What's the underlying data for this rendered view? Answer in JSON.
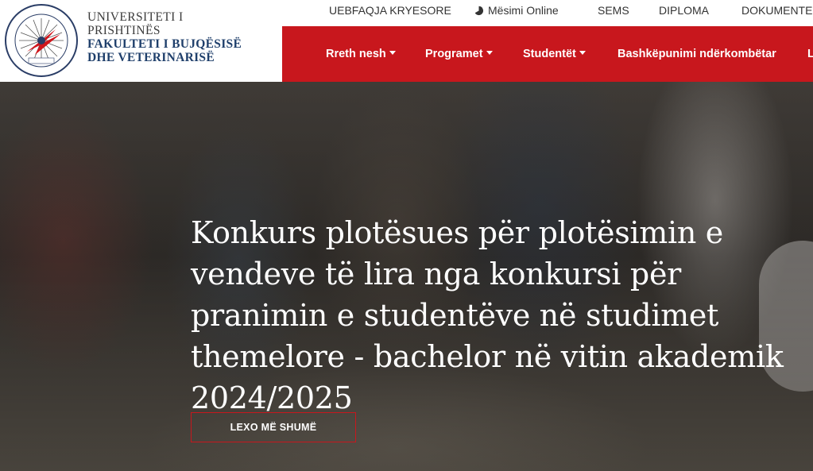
{
  "logo": {
    "university": [
      "UNIVERSITETI I",
      "PRISHTINËS"
    ],
    "faculty": [
      "FAKULTETI I BUJQËSISË",
      "DHE VETERINARISË"
    ]
  },
  "topbar": {
    "items": [
      "UEBFAQJA KRYESORE",
      "Mësimi Online",
      "SEMS",
      "DIPLOMA",
      "DOKUMENTE"
    ]
  },
  "mainnav": {
    "items": [
      "Rreth nesh",
      "Programet",
      "Studentët",
      "Bashkëpunimi ndërkombëtar",
      "L"
    ]
  },
  "hero": {
    "title": "Konkurs plotësues për plotësimin e vendeve të lira nga konkursi për pranimin e studentëve në studimet themelore - bachelor në vitin akademik 2024/2025",
    "cta": "LEXO MË SHUMË"
  },
  "colors": {
    "brand_red": "#c8171d",
    "faculty_blue": "#1f3f6b"
  }
}
